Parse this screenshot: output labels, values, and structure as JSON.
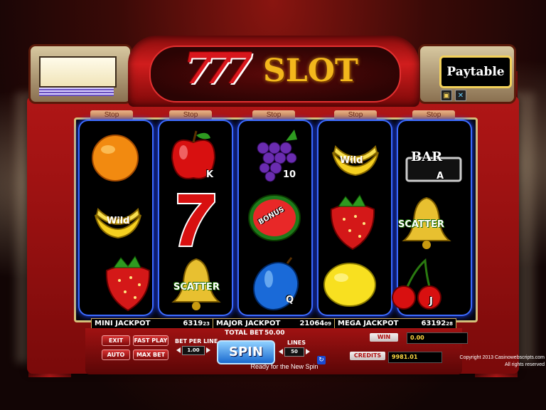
{
  "title": {
    "numerals": "777",
    "word": "SLOT"
  },
  "paytable_label": "Paytable",
  "stop_label": "Stop",
  "reels": [
    [
      {
        "symbol": "orange",
        "label": ""
      },
      {
        "symbol": "banana",
        "label": "Wild"
      },
      {
        "symbol": "strawberry",
        "label": ""
      }
    ],
    [
      {
        "symbol": "apple",
        "label": "K"
      },
      {
        "symbol": "seven",
        "label": ""
      },
      {
        "symbol": "bell",
        "label": "SCATTER"
      }
    ],
    [
      {
        "symbol": "grapes",
        "label": "10"
      },
      {
        "symbol": "watermelon",
        "label": "BONUS"
      },
      {
        "symbol": "plum",
        "label": "Q"
      }
    ],
    [
      {
        "symbol": "banana",
        "label": "Wild"
      },
      {
        "symbol": "strawberry",
        "label": ""
      },
      {
        "symbol": "lemon",
        "label": ""
      }
    ],
    [
      {
        "symbol": "bar",
        "label": "BAR"
      },
      {
        "symbol": "bell",
        "label": "SCATTER"
      },
      {
        "symbol": "cherries",
        "label": "J"
      }
    ]
  ],
  "reel_corner_labels": {
    "apple": "K",
    "grapes": "10",
    "plum": "Q",
    "bar": "A",
    "cherries": "J"
  },
  "jackpots": [
    {
      "name": "MINI JACKPOT",
      "value": "6319",
      "cents": "23"
    },
    {
      "name": "MAJOR JACKPOT",
      "value": "21064",
      "cents": "09"
    },
    {
      "name": "MEGA JACKPOT",
      "value": "63192",
      "cents": "28"
    }
  ],
  "controls": {
    "exit": "EXIT",
    "fast_play": "FAST PLAY",
    "auto": "AUTO",
    "max_bet": "MAX BET",
    "bet_per_line_label": "BET PER LINE",
    "bet_per_line_value": "1.00",
    "lines_label": "LINES",
    "lines_value": "50",
    "total_bet_label": "TOTAL BET",
    "total_bet_value": "50.00",
    "spin": "SPIN",
    "status": "Ready for the New Spin",
    "win_label": "WIN",
    "win_value": "0.00",
    "credits_label": "CREDITS",
    "credits_value": "9981.01"
  },
  "copyright": {
    "line1": "Copyright 2013 Casinowebscripts.com",
    "line2": "All rights reserved"
  },
  "colors": {
    "cabinet": "#b01616",
    "reel_glow": "#1c42ff",
    "logo_gold": "#f3b71c",
    "logo_red": "#d8161c"
  }
}
